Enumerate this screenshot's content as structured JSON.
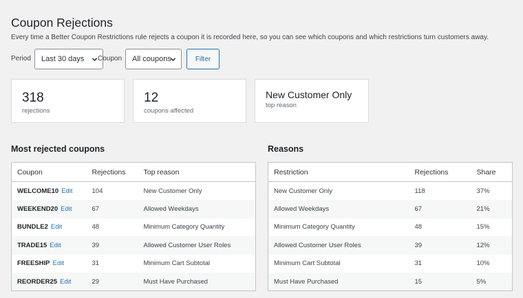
{
  "page": {
    "title": "Coupon Rejections",
    "description": "Every time a Better Coupon Restrictions rule rejects a coupon it is recorded here, so you can see which coupons and which restrictions turn customers away."
  },
  "filters": {
    "period_label": "Period",
    "period_value": "Last 30 days",
    "coupon_label": "Coupon",
    "coupon_value": "All coupons",
    "filter_button": "Filter"
  },
  "stats": {
    "rejections": {
      "value": "318",
      "label": "rejections"
    },
    "coupons": {
      "value": "12",
      "label": "coupons affected"
    },
    "top_reason": {
      "value": "New Customer Only",
      "label": "top reason"
    }
  },
  "coupons_table": {
    "heading": "Most rejected coupons",
    "columns": [
      "Coupon",
      "Rejections",
      "Top reason"
    ],
    "edit_label": "Edit",
    "rows": [
      {
        "code": "WELCOME10",
        "rejections": "104",
        "reason": "New Customer Only"
      },
      {
        "code": "WEEKEND20",
        "rejections": "67",
        "reason": "Allowed Weekdays"
      },
      {
        "code": "BUNDLE2",
        "rejections": "48",
        "reason": "Minimum Category Quantity"
      },
      {
        "code": "TRADE15",
        "rejections": "39",
        "reason": "Allowed Customer User Roles"
      },
      {
        "code": "FREESHIP",
        "rejections": "31",
        "reason": "Minimum Cart Subtotal"
      },
      {
        "code": "REORDER25",
        "rejections": "29",
        "reason": "Must Have Purchased"
      }
    ]
  },
  "reasons_table": {
    "heading": "Reasons",
    "columns": [
      "Restriction",
      "Rejections",
      "Share"
    ],
    "rows": [
      {
        "restriction": "New Customer Only",
        "rejections": "118",
        "share": "37%"
      },
      {
        "restriction": "Allowed Weekdays",
        "rejections": "67",
        "share": "21%"
      },
      {
        "restriction": "Minimum Category Quantity",
        "rejections": "48",
        "share": "15%"
      },
      {
        "restriction": "Allowed Customer User Roles",
        "rejections": "39",
        "share": "12%"
      },
      {
        "restriction": "Minimum Cart Subtotal",
        "rejections": "31",
        "share": "10%"
      },
      {
        "restriction": "Must Have Purchased",
        "rejections": "15",
        "share": "5%"
      }
    ]
  },
  "colors": {
    "accent": "#2271b1",
    "text": "#1d2327",
    "background": "#f1f1f1"
  }
}
